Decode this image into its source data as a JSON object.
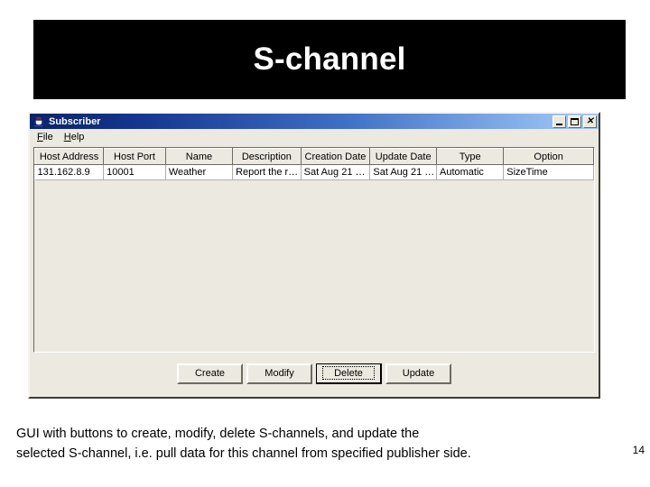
{
  "slide": {
    "banner_title": "S-channel",
    "page_number": "14",
    "caption_line1": "GUI with buttons to create, modify, delete S-channels, and update the",
    "caption_line2": "selected S-channel, i.e. pull data for this channel from specified publisher side."
  },
  "window": {
    "title": "Subscriber",
    "icon": "java-coffee-cup-icon",
    "controls": {
      "minimize": "minimize-icon",
      "maximize": "maximize-icon",
      "close": "close-icon"
    }
  },
  "menubar": {
    "items": [
      {
        "label": "File",
        "mnemonic": "F",
        "rest": "ile"
      },
      {
        "label": "Help",
        "mnemonic": "H",
        "rest": "elp"
      }
    ]
  },
  "table": {
    "columns": [
      "Host Address",
      "Host Port",
      "Name",
      "Description",
      "Creation Date",
      "Update Date",
      "Type",
      "Option"
    ],
    "rows": [
      [
        "131.162.8.9",
        "10001",
        "Weather",
        "Report the r…",
        "Sat Aug 21 …",
        "Sat Aug 21 …",
        "Automatic",
        "SizeTime"
      ]
    ]
  },
  "buttons": {
    "create": "Create",
    "modify": "Modify",
    "delete": "Delete",
    "update": "Update"
  },
  "colors": {
    "banner_background": "#000000",
    "banner_text": "#ffffff",
    "titlebar_start": "#0a246a",
    "titlebar_end": "#a6c8f5",
    "window_face": "#ece9e0",
    "table_background": "#ffffff"
  }
}
